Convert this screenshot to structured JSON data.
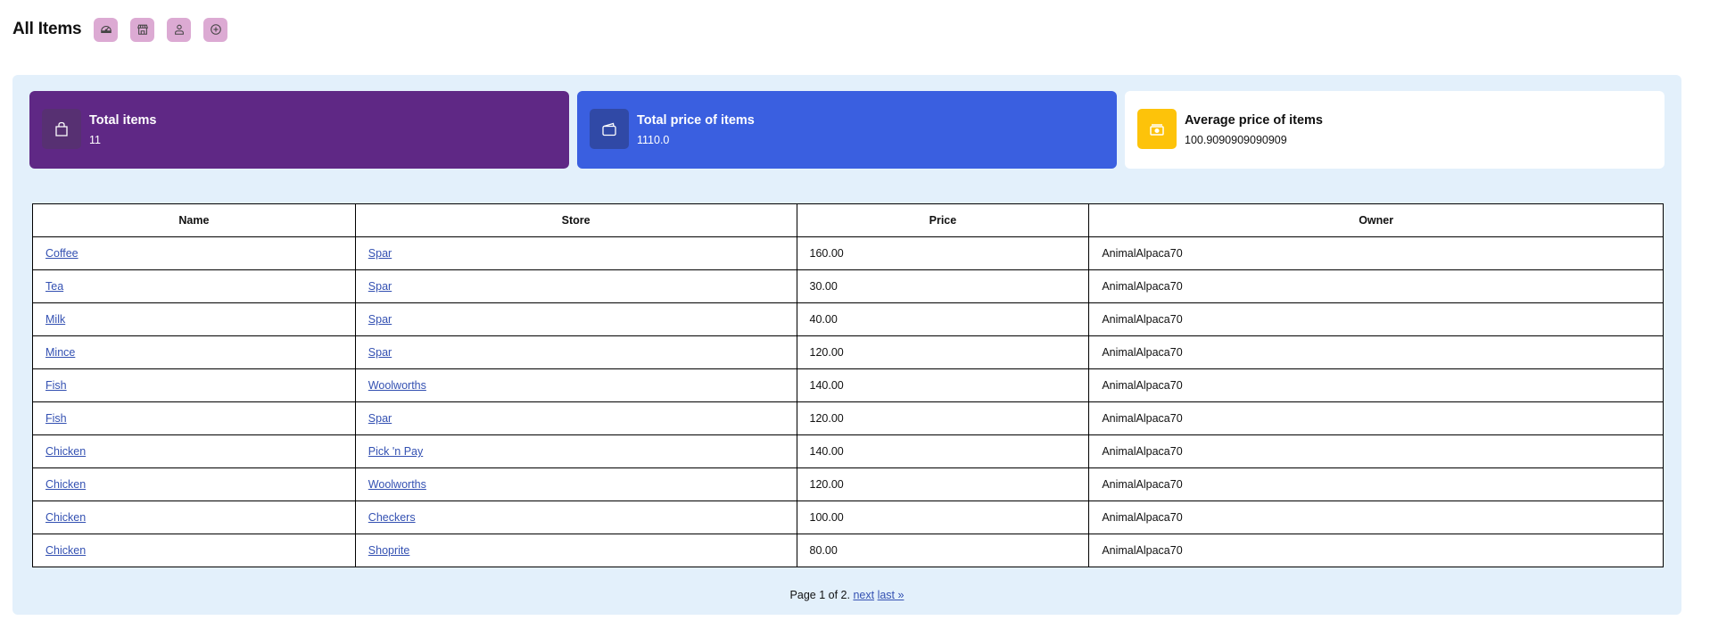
{
  "header": {
    "title": "All Items",
    "nav_buttons": [
      {
        "icon": "dashboard-gauge-icon",
        "label": "Dashboard"
      },
      {
        "icon": "store-icon",
        "label": "Stores"
      },
      {
        "icon": "user-icon",
        "label": "Profile"
      },
      {
        "icon": "plus-circle-icon",
        "label": "Add item"
      }
    ]
  },
  "stats": [
    {
      "title": "Total items",
      "value": "11",
      "icon": "shopping-bag-icon",
      "color": "#5f2885"
    },
    {
      "title": "Total price of items",
      "value": "1110.0",
      "icon": "wallet-icon",
      "color": "#3a5fe0"
    },
    {
      "title": "Average price of items",
      "value": "100.9090909090909",
      "icon": "cash-icon",
      "color": "#fdc30a"
    }
  ],
  "table": {
    "columns": [
      "Name",
      "Store",
      "Price",
      "Owner"
    ],
    "rows": [
      {
        "name": "Coffee",
        "store": "Spar",
        "price": "160.00",
        "owner": "AnimalAlpaca70"
      },
      {
        "name": "Tea",
        "store": "Spar",
        "price": "30.00",
        "owner": "AnimalAlpaca70"
      },
      {
        "name": "Milk",
        "store": "Spar",
        "price": "40.00",
        "owner": "AnimalAlpaca70"
      },
      {
        "name": "Mince",
        "store": "Spar",
        "price": "120.00",
        "owner": "AnimalAlpaca70"
      },
      {
        "name": "Fish",
        "store": "Woolworths",
        "price": "140.00",
        "owner": "AnimalAlpaca70"
      },
      {
        "name": "Fish",
        "store": "Spar",
        "price": "120.00",
        "owner": "AnimalAlpaca70"
      },
      {
        "name": "Chicken",
        "store": "Pick 'n Pay",
        "price": "140.00",
        "owner": "AnimalAlpaca70"
      },
      {
        "name": "Chicken",
        "store": "Woolworths",
        "price": "120.00",
        "owner": "AnimalAlpaca70"
      },
      {
        "name": "Chicken",
        "store": "Checkers",
        "price": "100.00",
        "owner": "AnimalAlpaca70"
      },
      {
        "name": "Chicken",
        "store": "Shoprite",
        "price": "80.00",
        "owner": "AnimalAlpaca70"
      }
    ]
  },
  "pagination": {
    "status": "Page 1 of 2.",
    "next_label": "next",
    "last_label": "last »"
  },
  "colors": {
    "link": "#3451b2",
    "nav_button_bg": "#dcaad3",
    "panel_bg": "#e3f0fb"
  }
}
